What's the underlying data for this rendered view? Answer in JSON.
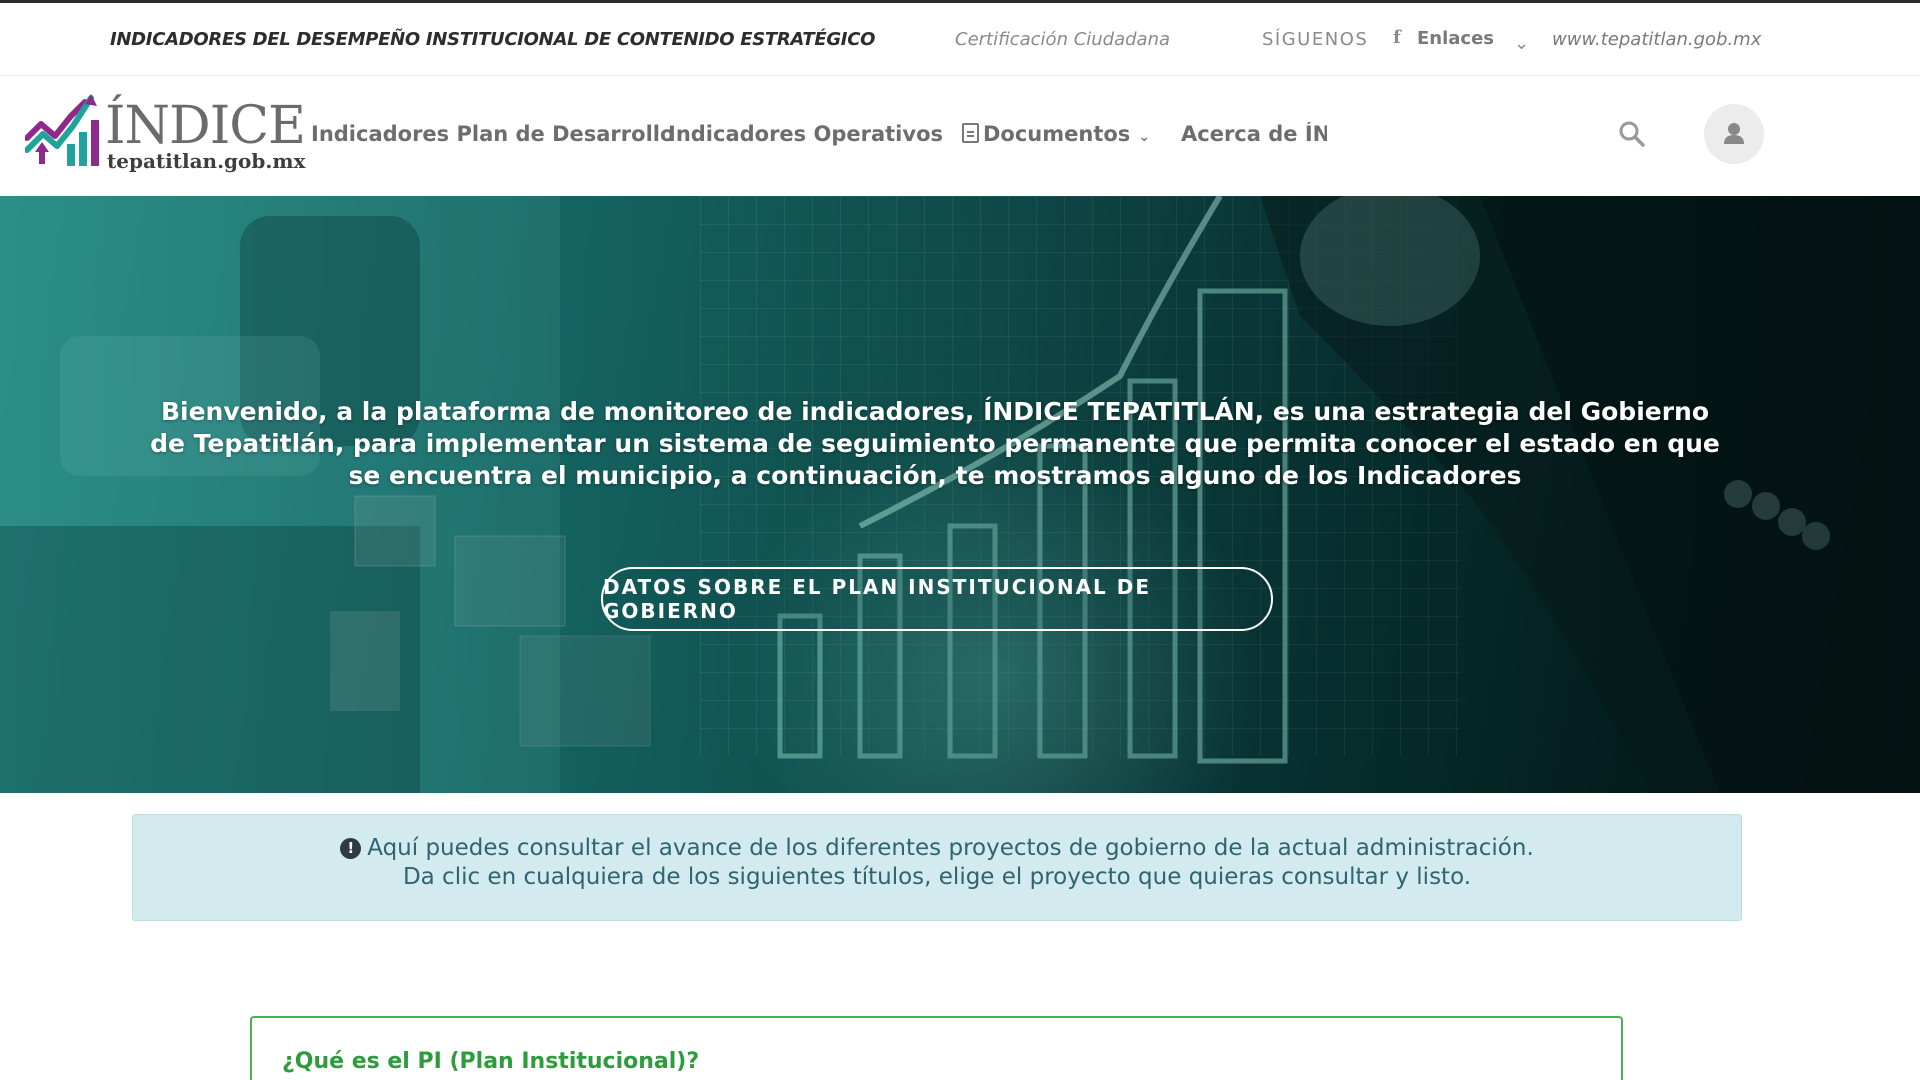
{
  "topbar": {
    "title": "INDICADORES DEL DESEMPEÑO INSTITUCIONAL DE CONTENIDO ESTRATÉGICO",
    "certificacion": "Certificación Ciudadana",
    "siguenos": "SÍGUENOS",
    "facebook_icon": "f",
    "enlaces": "Enlaces",
    "enlaces_chevron": "⌄",
    "website": "www.tepatitlan.gob.mx"
  },
  "logo": {
    "word": "ÍNDICE",
    "sub": "tepatitlan.gob.mx"
  },
  "nav": {
    "items": [
      {
        "label": "Indicadores Plan de Desarrollo"
      },
      {
        "label": "Indicadores Operativos"
      },
      {
        "label": "Documentos"
      },
      {
        "label": "Acerca de ÍND"
      }
    ],
    "documents_chevron": "⌄"
  },
  "hero": {
    "text": "Bienvenido, a la plataforma de monitoreo de indicadores, ÍNDICE TEPATITLÁN, es una estrategia del Gobierno de Tepatitlán, para implementar un sistema de seguimiento permanente que permita conocer el estado en que se encuentra el municipio, a continuación, te mostramos alguno de los Indicadores",
    "button": "DATOS SOBRE EL PLAN INSTITUCIONAL DE GOBIERNO"
  },
  "info": {
    "icon": "!",
    "line1": "Aquí puedes consultar el avance de los diferentes proyectos de gobierno de la actual administración.",
    "line2": "Da clic en cualquiera de los siguientes títulos, elige el proyecto que quieras consultar y listo."
  },
  "card": {
    "title": "¿Qué es el PI (Plan Institucional)?"
  },
  "colors": {
    "brand_purple": "#8e2a8b",
    "brand_teal": "#1fa39c",
    "card_green": "#4caf50",
    "info_bg": "#d3ebef"
  }
}
